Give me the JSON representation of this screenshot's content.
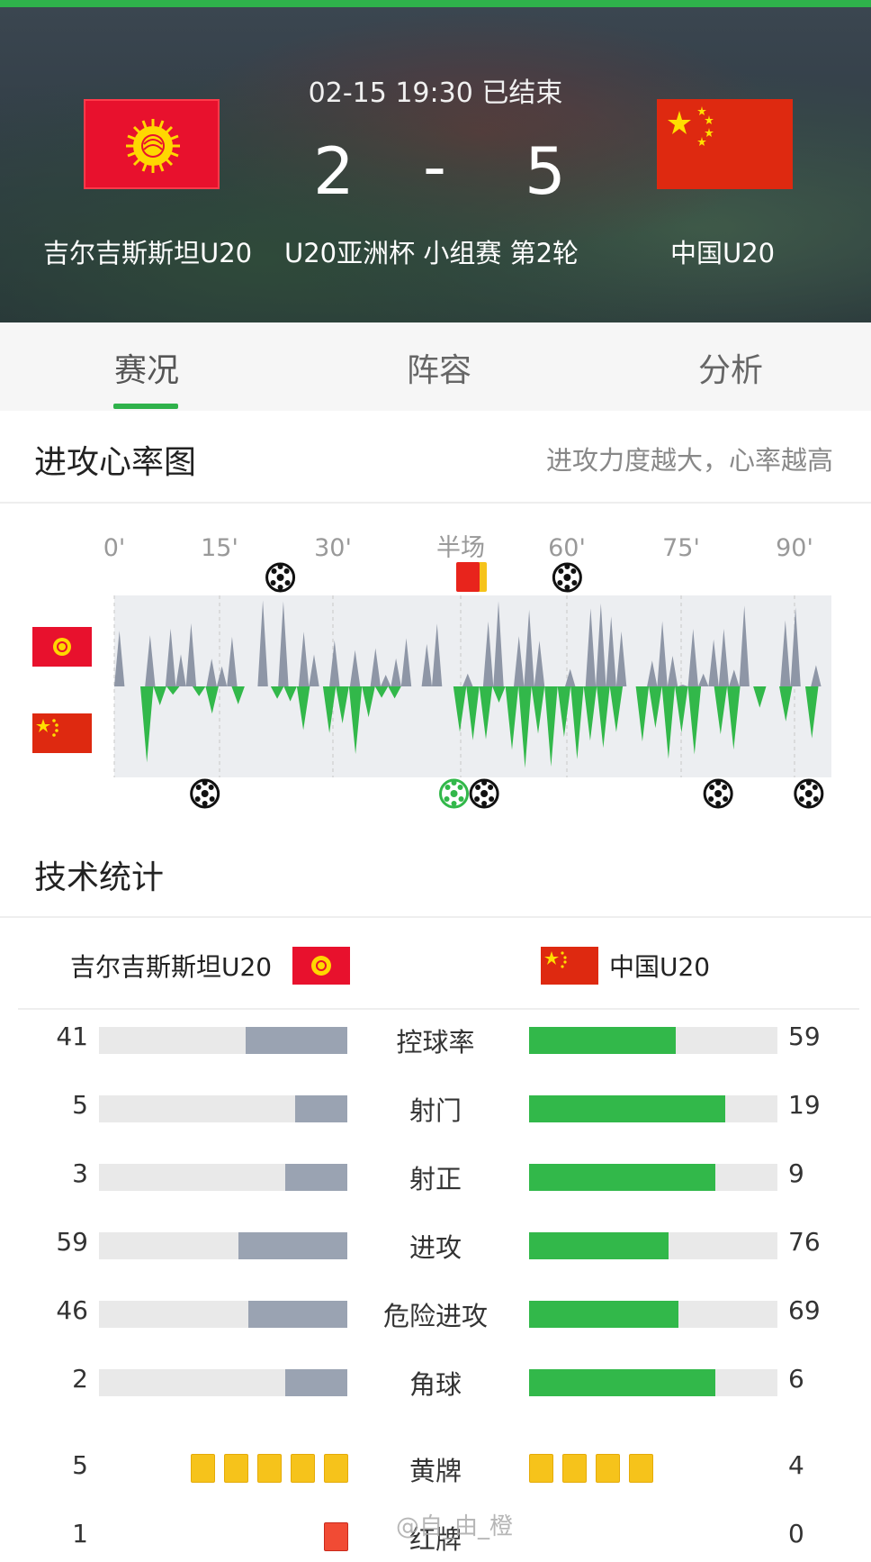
{
  "match": {
    "time_status": "02-15 19:30 已结束",
    "home_score": "2",
    "separator": "-",
    "away_score": "5",
    "home_team": "吉尔吉斯斯坦U20",
    "away_team": "中国U20",
    "competition": "U20亚洲杯 小组赛 第2轮"
  },
  "tabs": [
    {
      "label": "赛况",
      "active": true
    },
    {
      "label": "阵容",
      "active": false
    },
    {
      "label": "分析",
      "active": false
    }
  ],
  "heartbeat": {
    "title": "进攻心率图",
    "hint": "进攻力度越大，心率越高",
    "ticks": [
      "0'",
      "15'",
      "30'",
      "半场",
      "60'",
      "75'",
      "90'"
    ],
    "home_color": "#8e96a6",
    "away_color": "#32b84a",
    "home_goal_minutes": [
      22,
      60
    ],
    "away_goal_minutes": [
      12,
      45,
      49,
      80,
      92
    ],
    "home_cards_near": "half"
  },
  "stats": {
    "title": "技术统计",
    "home_team": "吉尔吉斯斯坦U20",
    "away_team": "中国U20",
    "rows": [
      {
        "label": "控球率",
        "home": "41",
        "away": "59",
        "home_frac": 0.41,
        "away_frac": 0.59
      },
      {
        "label": "射门",
        "home": "5",
        "away": "19",
        "home_frac": 0.21,
        "away_frac": 0.79
      },
      {
        "label": "射正",
        "home": "3",
        "away": "9",
        "home_frac": 0.25,
        "away_frac": 0.75
      },
      {
        "label": "进攻",
        "home": "59",
        "away": "76",
        "home_frac": 0.44,
        "away_frac": 0.56
      },
      {
        "label": "危险进攻",
        "home": "46",
        "away": "69",
        "home_frac": 0.4,
        "away_frac": 0.6
      },
      {
        "label": "角球",
        "home": "2",
        "away": "6",
        "home_frac": 0.25,
        "away_frac": 0.75
      }
    ],
    "yellow": {
      "label": "黄牌",
      "home": "5",
      "away": "4"
    },
    "red": {
      "label": "红牌",
      "home": "1",
      "away": "0"
    }
  },
  "watermark": "@自_由_橙",
  "colors": {
    "accent": "#2fb24b",
    "home_bar": "#9aa3b2",
    "away_bar": "#32b84a"
  }
}
